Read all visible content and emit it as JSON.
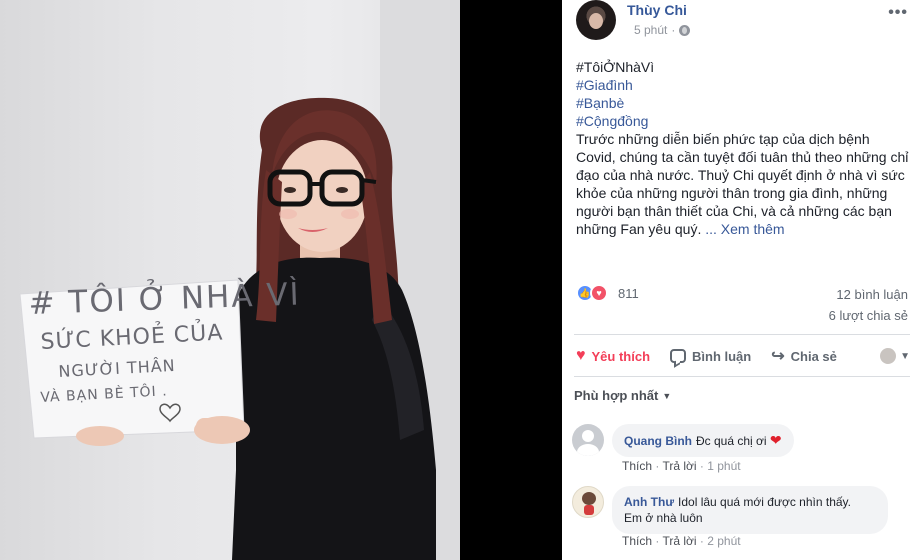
{
  "photo": {
    "sign_lines": [
      "# TÔI Ở NHÀ VÌ",
      "SỨC KHOẺ CỦA",
      "NGƯỜI THÂN",
      "VÀ BẠN BÈ TÔI ."
    ]
  },
  "post": {
    "author": "Thùy Chi",
    "time": "5 phút",
    "separator": "·",
    "more_label": "•••",
    "hashtags": [
      "#TôiỞNhàVì",
      "#Giađình",
      "#Bạnbè",
      "#Cộngđồng"
    ],
    "body": "Trước những diễn biến phức tạp của dịch bệnh Covid, chúng ta cần tuyệt đối tuân thủ theo những chỉ đạo của nhà nước. Thuỷ Chi quyết định ở nhà vì sức khỏe của những người thân trong gia đình, những người bạn thân thiết của Chi, và cả những các bạn những Fan yêu quý.",
    "see_more": "... Xem thêm"
  },
  "reactions": {
    "count": "811",
    "comments": "12 bình luận",
    "shares": "6 lượt chia sẻ"
  },
  "actions": {
    "like": "Yêu thích",
    "comment": "Bình luận",
    "share": "Chia sẻ"
  },
  "sort_label": "Phù hợp nhất",
  "comments": [
    {
      "name": "Quang Bình",
      "text": "Đc quá chị ơi",
      "emoji": "❤",
      "like": "Thích",
      "reply": "Trả lời",
      "time": "1 phút"
    },
    {
      "name": "Anh Thư",
      "text_line1": "Idol lâu quá mới được nhìn thấy.",
      "text_line2": "Em ở nhà luôn",
      "like": "Thích",
      "reply": "Trả lời",
      "time": "2 phút"
    }
  ],
  "colors": {
    "link_blue": "#385898",
    "love_red": "#f33e58",
    "like_blue": "#5890ff",
    "meta_gray": "#90949c"
  }
}
